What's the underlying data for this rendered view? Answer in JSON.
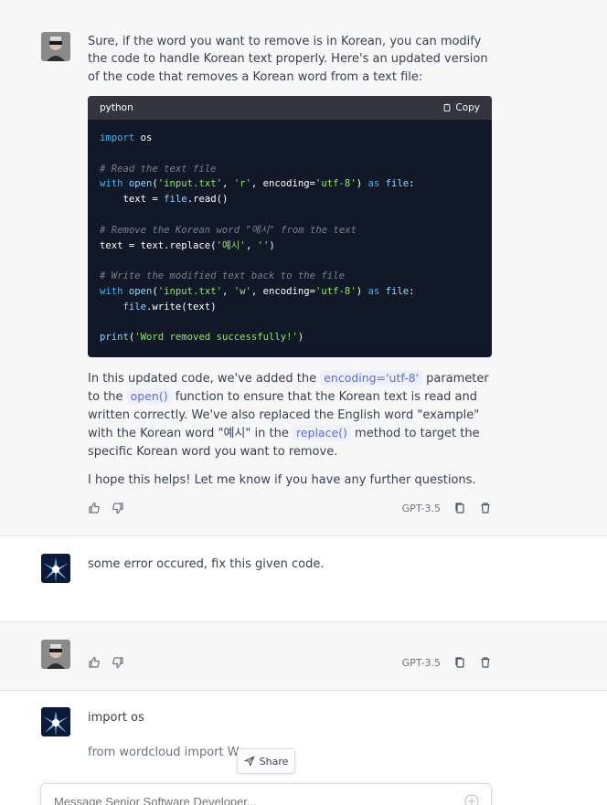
{
  "conversation": {
    "assistant_1": {
      "intro": "Sure, if the word you want to remove is in Korean, you can modify the code to handle Korean text properly. Here's an updated version of the code that removes a Korean word from a text file:",
      "code_lang": "python",
      "copy_label": "Copy",
      "code_lines": {
        "l1_kw": "import",
        "l1_rest": " os",
        "l3": "# Read the text file",
        "l4_kw": "with",
        "l4_fn": " open",
        "l4_a": "(",
        "l4_s1": "'input.txt'",
        "l4_b": ", ",
        "l4_s2": "'r'",
        "l4_c": ", encoding=",
        "l4_s3": "'utf-8'",
        "l4_d": ") ",
        "l4_kw2": "as",
        "l4_e": " ",
        "l4_fn2": "file",
        "l4_f": ":",
        "l5_a": "    text = ",
        "l5_fn": "file",
        "l5_b": ".read()",
        "l7": "# Remove the Korean word \"예시\" from the text",
        "l8_a": "text = text.replace(",
        "l8_s1": "'예시'",
        "l8_b": ", ",
        "l8_s2": "''",
        "l8_c": ")",
        "l10": "# Write the modified text back to the file",
        "l11_kw": "with",
        "l11_fn": " open",
        "l11_a": "(",
        "l11_s1": "'input.txt'",
        "l11_b": ", ",
        "l11_s2": "'w'",
        "l11_c": ", encoding=",
        "l11_s3": "'utf-8'",
        "l11_d": ") ",
        "l11_kw2": "as",
        "l11_e": " ",
        "l11_fn2": "file",
        "l11_f": ":",
        "l12_fn": "    file",
        "l12_a": ".write(text)",
        "l14_fn": "print",
        "l14_a": "(",
        "l14_s": "'Word removed successfully!'",
        "l14_b": ")"
      },
      "explain_1": "In this updated code, we've added the ",
      "code_encoding": "encoding='utf-8'",
      "explain_2": " parameter to the ",
      "code_open": "open()",
      "explain_3": " function to ensure that the Korean text is read and written correctly. We've also replaced the English word \"example\" with the Korean word \"예시\" in the ",
      "code_replace": "replace()",
      "explain_4": " method to target the specific Korean word you want to remove.",
      "closing": "I hope this helps! Let me know if you have any further questions.",
      "model": "GPT-3.5"
    },
    "user_1": {
      "text": "some error occured, fix this given code."
    },
    "assistant_2": {
      "model": "GPT-3.5"
    },
    "user_2": {
      "line1": "import os",
      "line2": "from wordcloud import Wo"
    }
  },
  "share_label": "Share",
  "composer": {
    "placeholder": "Message Senior Software Developer..."
  },
  "colors": {
    "code_bg": "#111827",
    "code_header": "#343541",
    "keyword": "#3fb6f4",
    "string": "#93e66f",
    "comment": "#7a7f8c",
    "inline_code": "#5a6fd8"
  }
}
